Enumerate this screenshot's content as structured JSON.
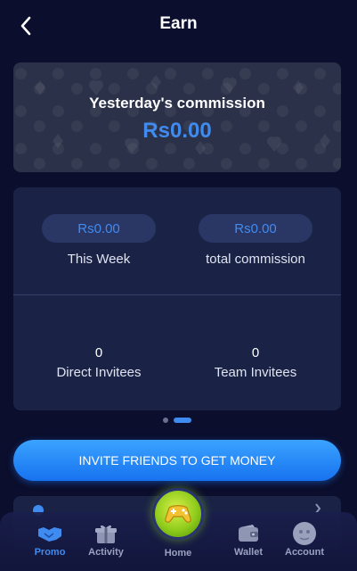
{
  "header": {
    "title": "Earn",
    "back_icon": "chevron-left-icon"
  },
  "yesterday": {
    "label": "Yesterday's commission",
    "value": "Rs0.00"
  },
  "stats": {
    "this_week": {
      "value": "Rs0.00",
      "label": "This Week"
    },
    "total_commission": {
      "value": "Rs0.00",
      "label": "total commission"
    },
    "direct_invitees": {
      "value": "0",
      "label": "Direct Invitees"
    },
    "team_invitees": {
      "value": "0",
      "label": "Team Invitees"
    }
  },
  "pager": {
    "count": 2,
    "active": 2
  },
  "invite_button": {
    "label": "INVITE FRIENDS TO GET MONEY"
  },
  "nav": {
    "promo": {
      "label": "Promo",
      "icon": "handshake-icon"
    },
    "activity": {
      "label": "Activity",
      "icon": "gift-icon"
    },
    "home": {
      "label": "Home",
      "icon": "gamepad-icon"
    },
    "wallet": {
      "label": "Wallet",
      "icon": "wallet-icon"
    },
    "account": {
      "label": "Account",
      "icon": "avatar-icon"
    }
  },
  "colors": {
    "accent": "#3f8bf0",
    "background": "#0b0e2c",
    "card": "#1a2346",
    "home": "#8fcc1c"
  }
}
